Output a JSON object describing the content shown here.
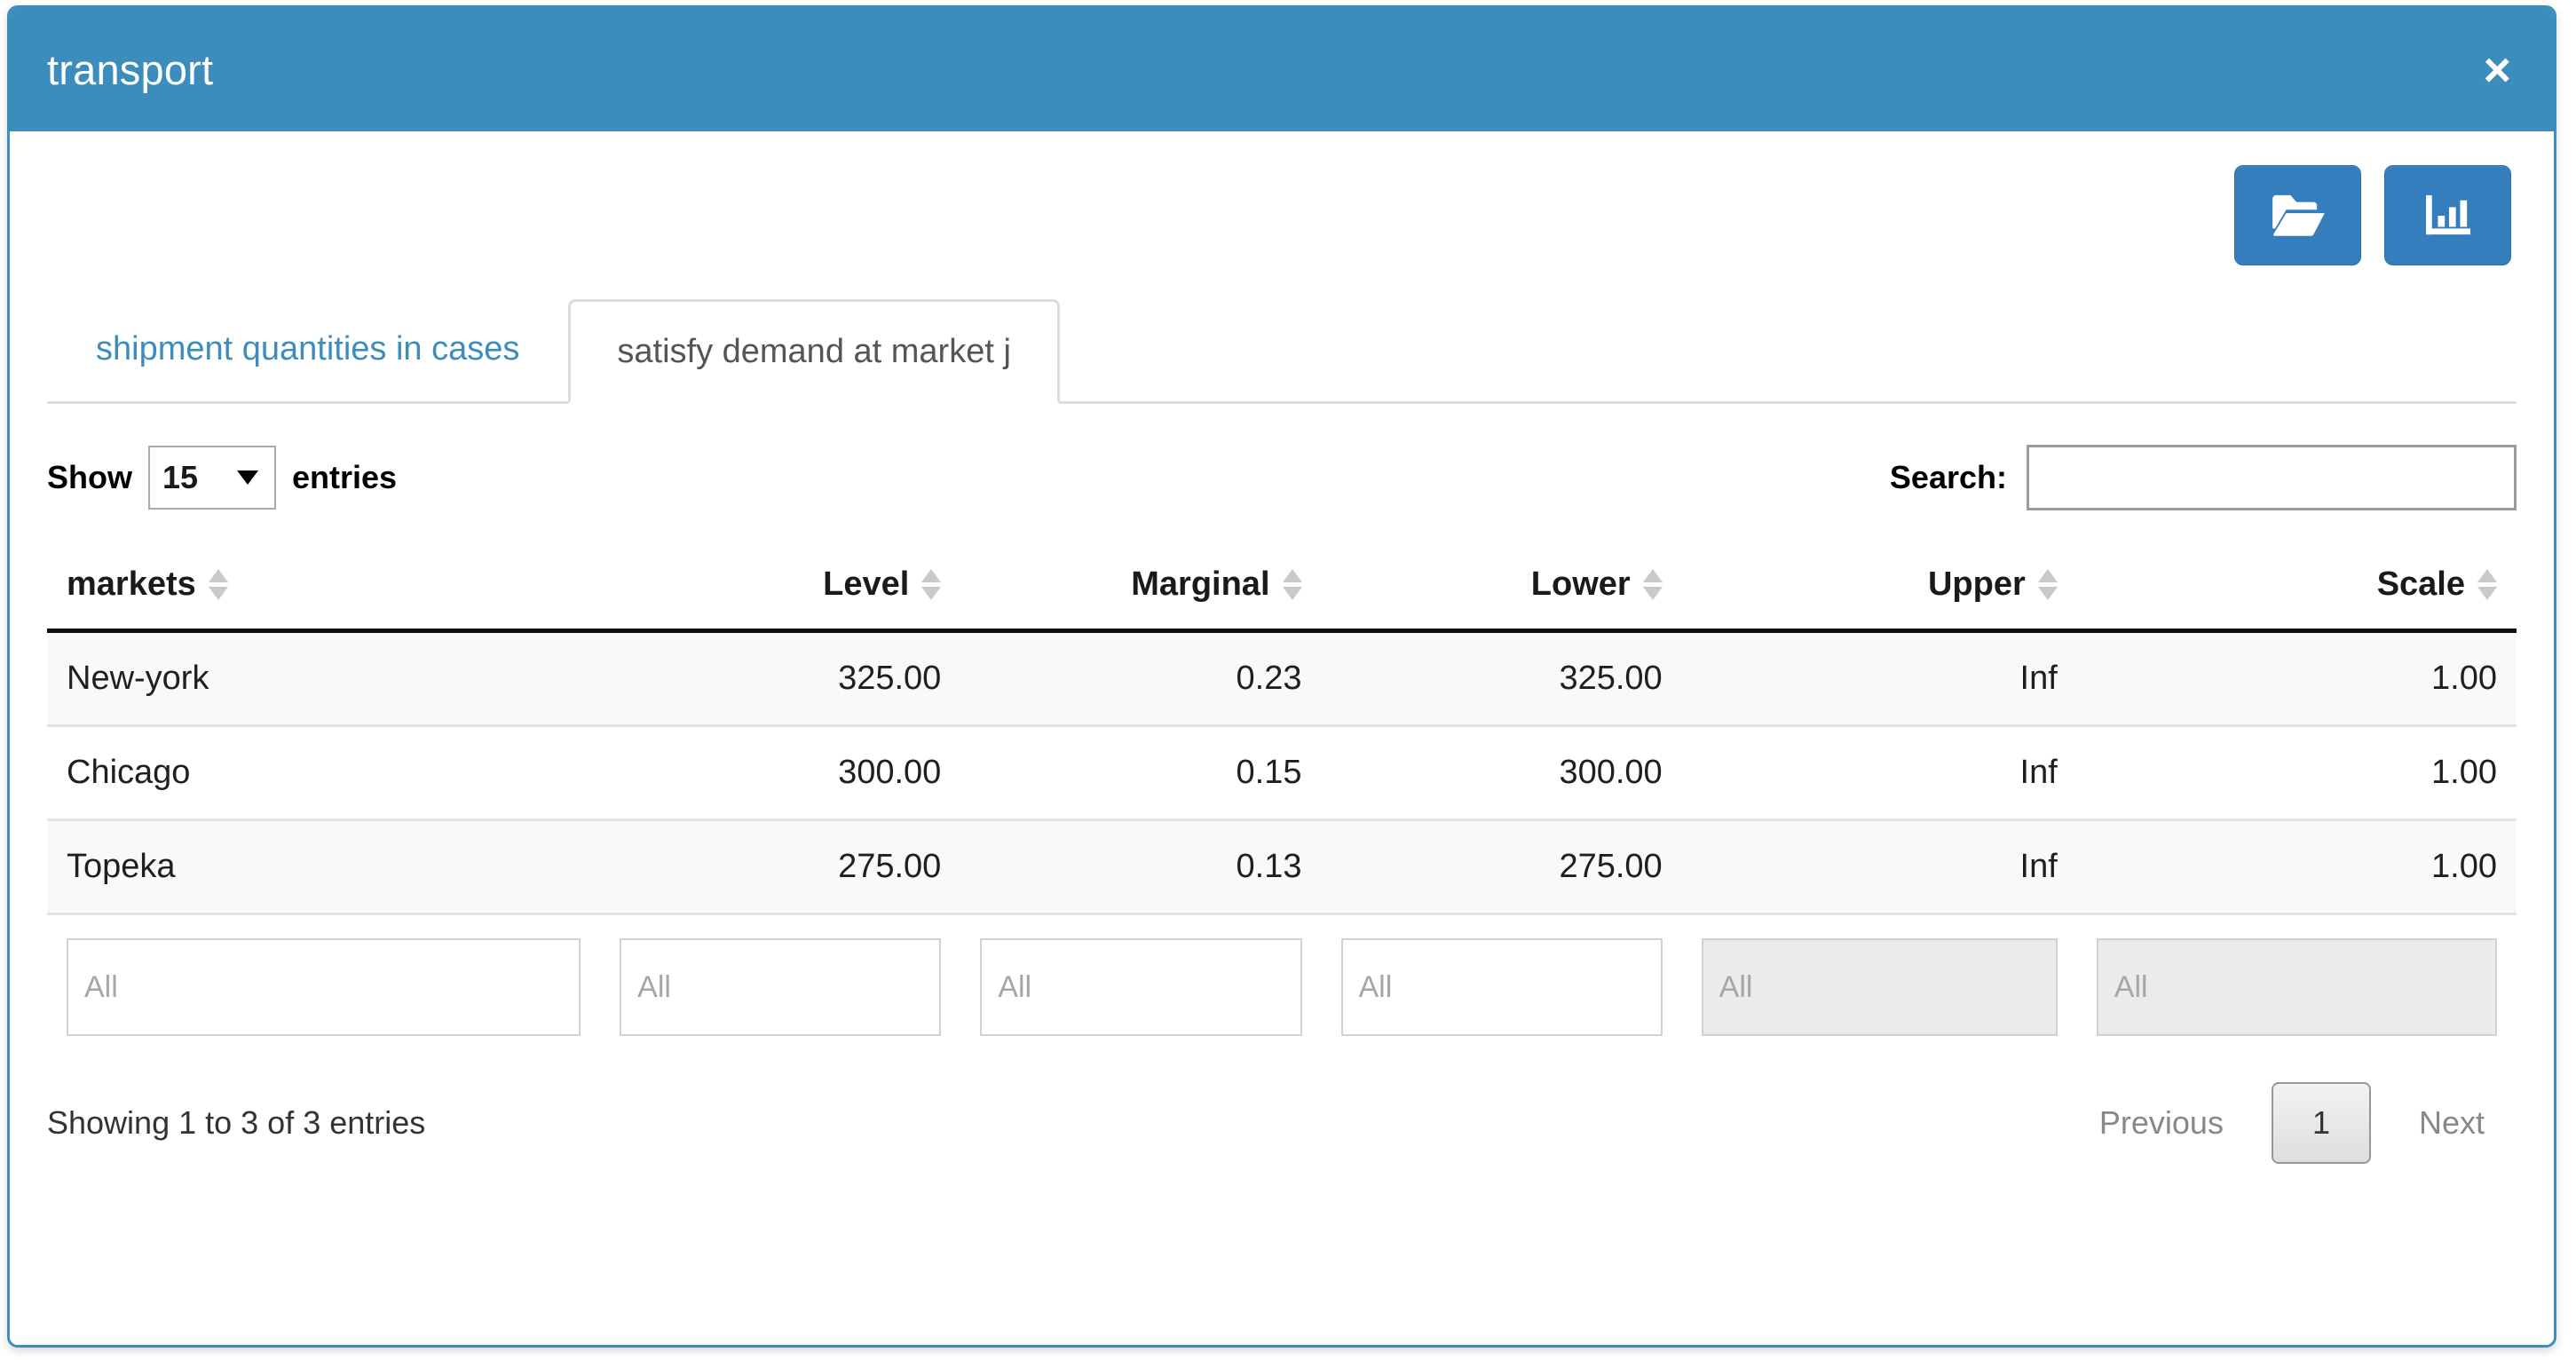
{
  "window": {
    "title": "transport",
    "close_label": "×"
  },
  "toolbar": {
    "buttons": [
      {
        "name": "open-folder-button",
        "icon": "folder-open-icon"
      },
      {
        "name": "chart-button",
        "icon": "bar-chart-icon"
      }
    ]
  },
  "tabs": [
    {
      "label": "shipment quantities in cases",
      "active": false
    },
    {
      "label": "satisfy demand at market j",
      "active": true
    }
  ],
  "controls": {
    "show_label": "Show",
    "entries_label": "entries",
    "page_length": "15",
    "page_length_options": [
      "15"
    ],
    "search_label": "Search:",
    "search_value": "",
    "search_placeholder": ""
  },
  "table": {
    "columns": [
      {
        "label": "markets",
        "align": "left"
      },
      {
        "label": "Level",
        "align": "right"
      },
      {
        "label": "Marginal",
        "align": "right"
      },
      {
        "label": "Lower",
        "align": "right"
      },
      {
        "label": "Upper",
        "align": "right"
      },
      {
        "label": "Scale",
        "align": "right"
      }
    ],
    "rows": [
      {
        "markets": "New-york",
        "level": "325.00",
        "marginal": "0.23",
        "lower": "325.00",
        "upper": "Inf",
        "scale": "1.00"
      },
      {
        "markets": "Chicago",
        "level": "300.00",
        "marginal": "0.15",
        "lower": "300.00",
        "upper": "Inf",
        "scale": "1.00"
      },
      {
        "markets": "Topeka",
        "level": "275.00",
        "marginal": "0.13",
        "lower": "275.00",
        "upper": "Inf",
        "scale": "1.00"
      }
    ],
    "filters": [
      {
        "placeholder": "All",
        "disabled": false
      },
      {
        "placeholder": "All",
        "disabled": false
      },
      {
        "placeholder": "All",
        "disabled": false
      },
      {
        "placeholder": "All",
        "disabled": false
      },
      {
        "placeholder": "All",
        "disabled": true
      },
      {
        "placeholder": "All",
        "disabled": true
      }
    ]
  },
  "footer": {
    "info": "Showing 1 to 3 of 3 entries",
    "previous_label": "Previous",
    "current_page": "1",
    "next_label": "Next"
  },
  "colors": {
    "accent": "#3c8dbc",
    "button": "#357ebd",
    "link": "#3c8dbc",
    "row_stripe": "#f9f9f9",
    "disabled_input": "#ebebeb"
  }
}
